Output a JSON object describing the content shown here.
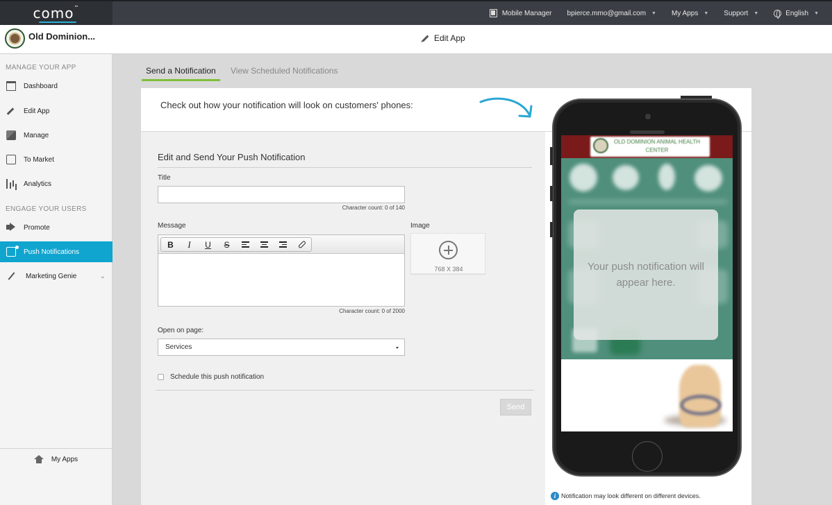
{
  "brand": {
    "name": "como",
    "tm": "™",
    "accent": "#29b0d8"
  },
  "topnav": {
    "mobile_manager": "Mobile Manager",
    "account": "bpierce.mmo@gmail.com",
    "my_apps": "My Apps",
    "support": "Support",
    "language": "English"
  },
  "header": {
    "app_name": "Old Dominion...",
    "page_title": "Edit App"
  },
  "sidebar": {
    "manage_label": "MANAGE YOUR APP",
    "engage_label": "ENGAGE YOUR USERS",
    "items": [
      {
        "label": "Dashboard",
        "icon": "dashboard-icon"
      },
      {
        "label": "Edit App",
        "icon": "pencil-icon"
      },
      {
        "label": "Manage",
        "icon": "box-icon"
      },
      {
        "label": "To Market",
        "icon": "phone-icon"
      },
      {
        "label": "Analytics",
        "icon": "bar-chart-icon"
      },
      {
        "label": "Promote",
        "icon": "megaphone-icon"
      },
      {
        "label": "Push Notifications",
        "icon": "push-phone-icon",
        "active": true
      },
      {
        "label": "Marketing Genie",
        "icon": "magic-wand-icon"
      }
    ],
    "bottom": "My Apps",
    "active_color": "#0fa5cf"
  },
  "tabs": {
    "send": "Send a Notification",
    "scheduled": "View Scheduled Notifications",
    "active_color": "#7fbf3a"
  },
  "banner": {
    "text": "Check out how your notification will look on customers' phones:"
  },
  "form": {
    "heading": "Edit and Send Your Push Notification",
    "title_label": "Title",
    "title_value": "",
    "title_count": "Character count: 0 of 140",
    "message_label": "Message",
    "message_value": "",
    "message_count": "Character count: 0 of 2000",
    "toolbar": {
      "bold": "B",
      "italic": "I",
      "underline": "U",
      "strike": "S"
    },
    "image_label": "Image",
    "image_size": "768 X 384",
    "open_on_label": "Open on page:",
    "open_on_value": "Services",
    "schedule_label": "Schedule this push notification",
    "send_label": "Send"
  },
  "preview": {
    "placeholder": "Your push notification will appear here.",
    "app_header_text": "OLD DOMINION ANIMAL HEALTH CENTER",
    "header_color": "#7b1a1a",
    "screen_color": "#4f8f7b"
  },
  "footnote": "Notification may look different on different devices."
}
